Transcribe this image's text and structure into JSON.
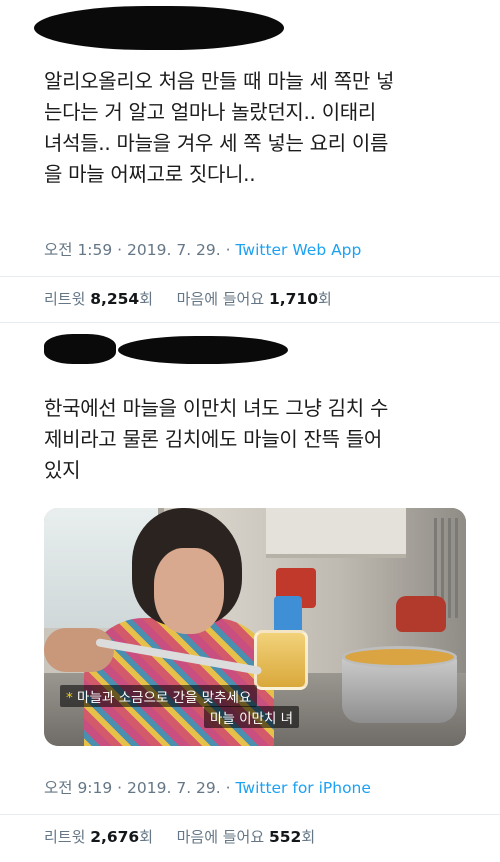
{
  "tweet1": {
    "text_lines": [
      "알리오올리오 처음 만들 때 마늘 세 쪽만 넣",
      "는다는 거 알고 얼마나 놀랐던지..  이태리",
      "녀석들.. 마늘을 겨우 세 쪽 넣는 요리 이름",
      "을 마늘 어쩌고로 짓다니.."
    ],
    "time": "오전 1:59 · 2019. 7. 29. · ",
    "source": "Twitter Web App",
    "retweet_label": "리트윗",
    "retweet_count": "8,254",
    "count_suffix": "회",
    "like_label": "마음에 들어요",
    "like_count": "1,710"
  },
  "tweet2": {
    "text_lines": [
      "한국에선 마늘을 이만치 녀도 그냥 김치 수",
      "제비라고 물론 김치에도 마늘이 잔뜩 들어",
      "있지"
    ],
    "media": {
      "caption_1": "마늘과 소금으로 간을 맞추세요",
      "caption_bullet": "*",
      "caption_2": "마늘 이만치 녀"
    },
    "time": "오전 9:19 · 2019. 7. 29. · ",
    "source": "Twitter for iPhone",
    "retweet_label": "리트윗",
    "retweet_count": "2,676",
    "count_suffix": "회",
    "like_label": "마음에 들어요",
    "like_count": "552"
  }
}
